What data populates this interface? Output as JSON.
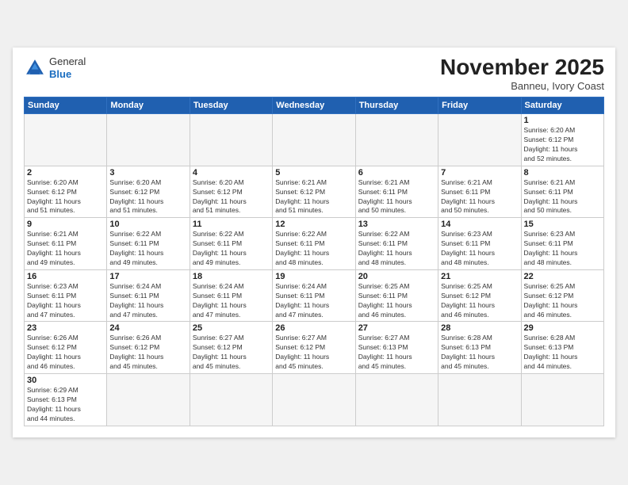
{
  "header": {
    "logo": {
      "general": "General",
      "blue": "Blue"
    },
    "title": "November 2025",
    "location": "Banneu, Ivory Coast"
  },
  "weekdays": [
    "Sunday",
    "Monday",
    "Tuesday",
    "Wednesday",
    "Thursday",
    "Friday",
    "Saturday"
  ],
  "weeks": [
    [
      {
        "day": "",
        "info": ""
      },
      {
        "day": "",
        "info": ""
      },
      {
        "day": "",
        "info": ""
      },
      {
        "day": "",
        "info": ""
      },
      {
        "day": "",
        "info": ""
      },
      {
        "day": "",
        "info": ""
      },
      {
        "day": "1",
        "info": "Sunrise: 6:20 AM\nSunset: 6:12 PM\nDaylight: 11 hours\nand 52 minutes."
      }
    ],
    [
      {
        "day": "2",
        "info": "Sunrise: 6:20 AM\nSunset: 6:12 PM\nDaylight: 11 hours\nand 51 minutes."
      },
      {
        "day": "3",
        "info": "Sunrise: 6:20 AM\nSunset: 6:12 PM\nDaylight: 11 hours\nand 51 minutes."
      },
      {
        "day": "4",
        "info": "Sunrise: 6:20 AM\nSunset: 6:12 PM\nDaylight: 11 hours\nand 51 minutes."
      },
      {
        "day": "5",
        "info": "Sunrise: 6:21 AM\nSunset: 6:12 PM\nDaylight: 11 hours\nand 51 minutes."
      },
      {
        "day": "6",
        "info": "Sunrise: 6:21 AM\nSunset: 6:11 PM\nDaylight: 11 hours\nand 50 minutes."
      },
      {
        "day": "7",
        "info": "Sunrise: 6:21 AM\nSunset: 6:11 PM\nDaylight: 11 hours\nand 50 minutes."
      },
      {
        "day": "8",
        "info": "Sunrise: 6:21 AM\nSunset: 6:11 PM\nDaylight: 11 hours\nand 50 minutes."
      }
    ],
    [
      {
        "day": "9",
        "info": "Sunrise: 6:21 AM\nSunset: 6:11 PM\nDaylight: 11 hours\nand 49 minutes."
      },
      {
        "day": "10",
        "info": "Sunrise: 6:22 AM\nSunset: 6:11 PM\nDaylight: 11 hours\nand 49 minutes."
      },
      {
        "day": "11",
        "info": "Sunrise: 6:22 AM\nSunset: 6:11 PM\nDaylight: 11 hours\nand 49 minutes."
      },
      {
        "day": "12",
        "info": "Sunrise: 6:22 AM\nSunset: 6:11 PM\nDaylight: 11 hours\nand 48 minutes."
      },
      {
        "day": "13",
        "info": "Sunrise: 6:22 AM\nSunset: 6:11 PM\nDaylight: 11 hours\nand 48 minutes."
      },
      {
        "day": "14",
        "info": "Sunrise: 6:23 AM\nSunset: 6:11 PM\nDaylight: 11 hours\nand 48 minutes."
      },
      {
        "day": "15",
        "info": "Sunrise: 6:23 AM\nSunset: 6:11 PM\nDaylight: 11 hours\nand 48 minutes."
      }
    ],
    [
      {
        "day": "16",
        "info": "Sunrise: 6:23 AM\nSunset: 6:11 PM\nDaylight: 11 hours\nand 47 minutes."
      },
      {
        "day": "17",
        "info": "Sunrise: 6:24 AM\nSunset: 6:11 PM\nDaylight: 11 hours\nand 47 minutes."
      },
      {
        "day": "18",
        "info": "Sunrise: 6:24 AM\nSunset: 6:11 PM\nDaylight: 11 hours\nand 47 minutes."
      },
      {
        "day": "19",
        "info": "Sunrise: 6:24 AM\nSunset: 6:11 PM\nDaylight: 11 hours\nand 47 minutes."
      },
      {
        "day": "20",
        "info": "Sunrise: 6:25 AM\nSunset: 6:11 PM\nDaylight: 11 hours\nand 46 minutes."
      },
      {
        "day": "21",
        "info": "Sunrise: 6:25 AM\nSunset: 6:12 PM\nDaylight: 11 hours\nand 46 minutes."
      },
      {
        "day": "22",
        "info": "Sunrise: 6:25 AM\nSunset: 6:12 PM\nDaylight: 11 hours\nand 46 minutes."
      }
    ],
    [
      {
        "day": "23",
        "info": "Sunrise: 6:26 AM\nSunset: 6:12 PM\nDaylight: 11 hours\nand 46 minutes."
      },
      {
        "day": "24",
        "info": "Sunrise: 6:26 AM\nSunset: 6:12 PM\nDaylight: 11 hours\nand 45 minutes."
      },
      {
        "day": "25",
        "info": "Sunrise: 6:27 AM\nSunset: 6:12 PM\nDaylight: 11 hours\nand 45 minutes."
      },
      {
        "day": "26",
        "info": "Sunrise: 6:27 AM\nSunset: 6:12 PM\nDaylight: 11 hours\nand 45 minutes."
      },
      {
        "day": "27",
        "info": "Sunrise: 6:27 AM\nSunset: 6:13 PM\nDaylight: 11 hours\nand 45 minutes."
      },
      {
        "day": "28",
        "info": "Sunrise: 6:28 AM\nSunset: 6:13 PM\nDaylight: 11 hours\nand 45 minutes."
      },
      {
        "day": "29",
        "info": "Sunrise: 6:28 AM\nSunset: 6:13 PM\nDaylight: 11 hours\nand 44 minutes."
      }
    ],
    [
      {
        "day": "30",
        "info": "Sunrise: 6:29 AM\nSunset: 6:13 PM\nDaylight: 11 hours\nand 44 minutes."
      },
      {
        "day": "",
        "info": ""
      },
      {
        "day": "",
        "info": ""
      },
      {
        "day": "",
        "info": ""
      },
      {
        "day": "",
        "info": ""
      },
      {
        "day": "",
        "info": ""
      },
      {
        "day": "",
        "info": ""
      }
    ]
  ]
}
